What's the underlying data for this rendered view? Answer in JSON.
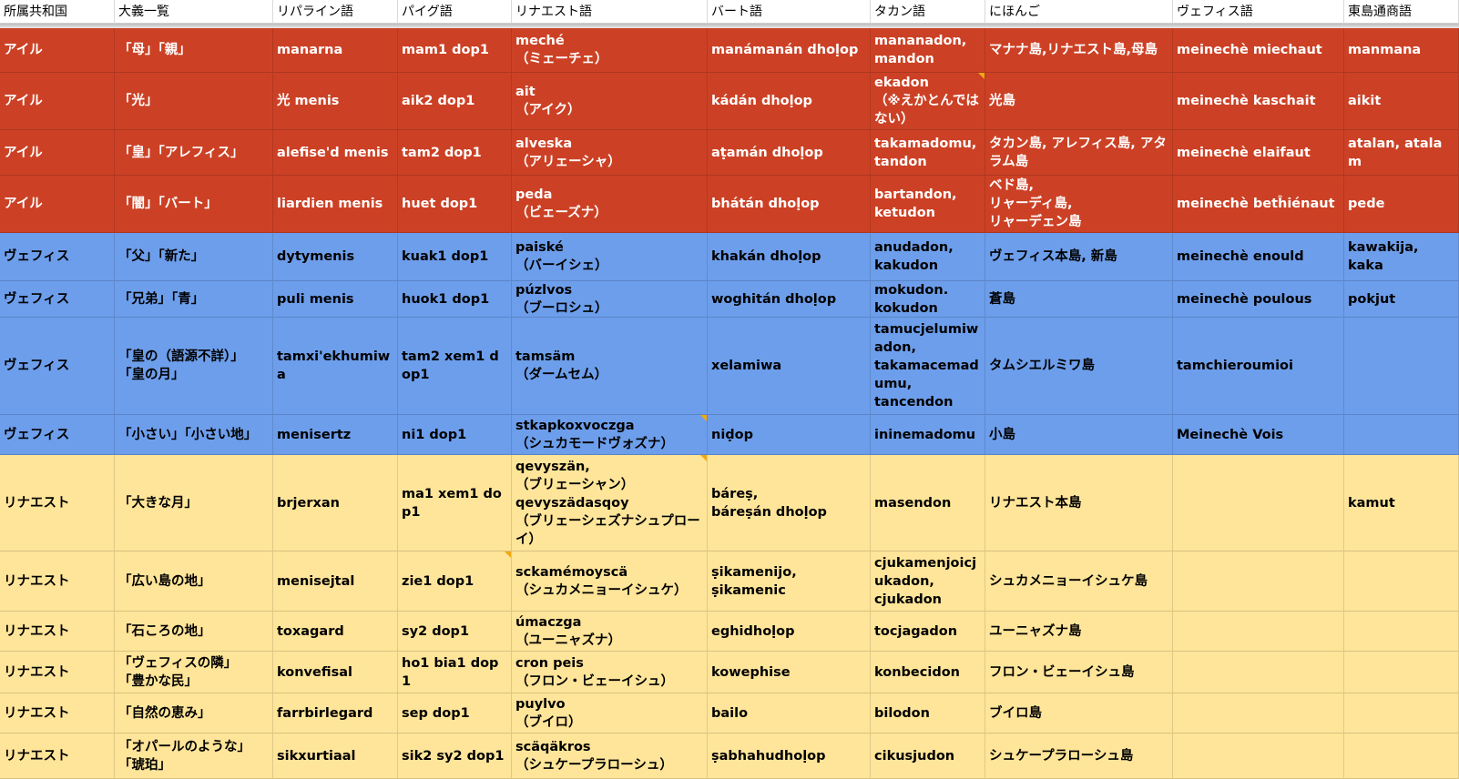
{
  "headers": [
    "所属共和国",
    "大義一覧",
    "リパライン語",
    "パイグ語",
    "リナエスト語",
    "バート語",
    "タカン語",
    "にほんご",
    "ヴェフィス語",
    "東島通商語"
  ],
  "rows": [
    {
      "group": "aile",
      "cells": [
        "アイル",
        "「母」「親」",
        "manarna",
        "mam1 dop1",
        "meché\n（ミェーチェ）",
        "manámanán dhoḷop",
        "mananadon,\nmandon",
        "マナナ島,リナエスト島,母島",
        "meinechè miechaut",
        "manmana"
      ]
    },
    {
      "group": "aile",
      "cells": [
        "アイル",
        "「光」",
        "光 menis",
        "aik2 dop1",
        "ait\n（アイク）",
        "kádán dhoḷop",
        "ekadon\n（※えかとんではない）",
        "光島",
        "meinechè kaschait",
        "aikit"
      ]
    },
    {
      "group": "aile",
      "cells": [
        "アイル",
        "「皇」「アレフィス」",
        "alefise'd menis",
        "tam2 dop1",
        "alveska\n（アリェーシャ）",
        "aṭamán dhoḷop",
        "takamadomu,\ntandon",
        "タカン島, アレフィス島, アタラム島",
        "meinechè elaifaut",
        "atalan, atalam"
      ]
    },
    {
      "group": "aile",
      "cells": [
        "アイル",
        "「闇」「バート」",
        "liardien menis",
        "huet dop1",
        "peda\n（ビェーズナ）",
        "bhátán dhoḷop",
        "bartandon,\nketudon",
        "ベド島,\nリャーディ島,\nリャーデェン島",
        "meinechè betĥiénaut",
        "pede"
      ]
    },
    {
      "group": "vefis",
      "cells": [
        "ヴェフィス",
        "「父」「新た」",
        "dytymenis",
        "kuak1 dop1",
        "paiské\n（バーイシェ）",
        "khakán dhoḷop",
        "anudadon,\nkakudon",
        "ヴェフィス本島, 新島",
        "meinechè enould",
        "kawakija,\nkaka"
      ]
    },
    {
      "group": "vefis",
      "cells": [
        "ヴェフィス",
        "「兄弟」「青」",
        "puli menis",
        "huok1 dop1",
        "púzlvos\n（ブーロシュ）",
        "woghitán dhoḷop",
        "mokudon.\nkokudon",
        "蒼島",
        "meinechè poulous",
        "pokjut"
      ]
    },
    {
      "group": "vefis",
      "cells": [
        "ヴェフィス",
        "「皇の（語源不詳）」\n「皇の月」",
        "tamxi'ekhumiwa",
        "tam2 xem1 dop1",
        "tamsäm\n（ダームセム）",
        "xelamiwa",
        "tamucjelumiwadon,\ntakamacemadumu,\ntancendon",
        "タムシエルミワ島",
        "tamchieroumioi",
        ""
      ]
    },
    {
      "group": "vefis",
      "cells": [
        "ヴェフィス",
        "「小さい」「小さい地」",
        "menisertz",
        "ni1 dop1",
        "stkapkoxvoczga\n（シュカモードヴォズナ）",
        "niḍop",
        "ininemadomu",
        "小島",
        "Meinechè Vois",
        ""
      ]
    },
    {
      "group": "rina",
      "cells": [
        "リナエスト",
        "「大きな月」",
        "brjerxan",
        "ma1 xem1 dop1",
        "qevyszän,\n（ブリェーシャン）\nqevyszädasqoy\n（ブリェーシェズナシュプローイ）",
        "báreṣ,\nbáreṣán dhoḷop",
        "masendon",
        "リナエスト本島",
        "",
        "kamut"
      ]
    },
    {
      "group": "rina",
      "cells": [
        "リナエスト",
        "「広い島の地」",
        "menisejtal",
        "zie1 dop1",
        "sckamémoyscä\n（シュカメニョーイシュケ）",
        "ṣikamenijo,\nṣikamenic",
        "cjukamenjoicjukadon,\ncjukadon",
        "シュカメニョーイシュケ島",
        "",
        ""
      ]
    },
    {
      "group": "rina",
      "cells": [
        "リナエスト",
        "「石ころの地」",
        "toxagard",
        "sy2 dop1",
        "úmaczga\n（ユーニャズナ）",
        "eghidhoḷop",
        "tocjagadon",
        "ユーニャズナ島",
        "",
        ""
      ]
    },
    {
      "group": "rina",
      "cells": [
        "リナエスト",
        "「ヴェフィスの隣」\n「豊かな民」",
        "konvefisal",
        "ho1 bia1 dop1",
        "cron peis\n（フロン・ビェーイシュ）",
        "kowephise",
        "konbecidon",
        "フロン・ビェーイシュ島",
        "",
        ""
      ]
    },
    {
      "group": "rina",
      "cells": [
        "リナエスト",
        "「自然の恵み」",
        "farrbirlegard",
        "sep dop1",
        "puylvo\n（ブイロ）",
        "bailo",
        "bilodon",
        "ブイロ島",
        "",
        ""
      ]
    },
    {
      "group": "rina",
      "cells": [
        "リナエスト",
        "「オパールのような」\n「琥珀」",
        "sikxurtiaal",
        "sik2 sy2 dop1",
        "scäqäkros\n（シュケープラローシュ）",
        "ṣabhahudhoḷop",
        "cikusjudon",
        "シュケープラローシュ島",
        "",
        ""
      ]
    }
  ],
  "colors": {
    "aile": "#cc4125",
    "vefis": "#6d9eeb",
    "rina": "#ffe599",
    "note": "#f1a812"
  },
  "notes": [
    [
      1,
      6
    ],
    [
      7,
      4
    ],
    [
      8,
      4
    ],
    [
      9,
      3
    ]
  ]
}
